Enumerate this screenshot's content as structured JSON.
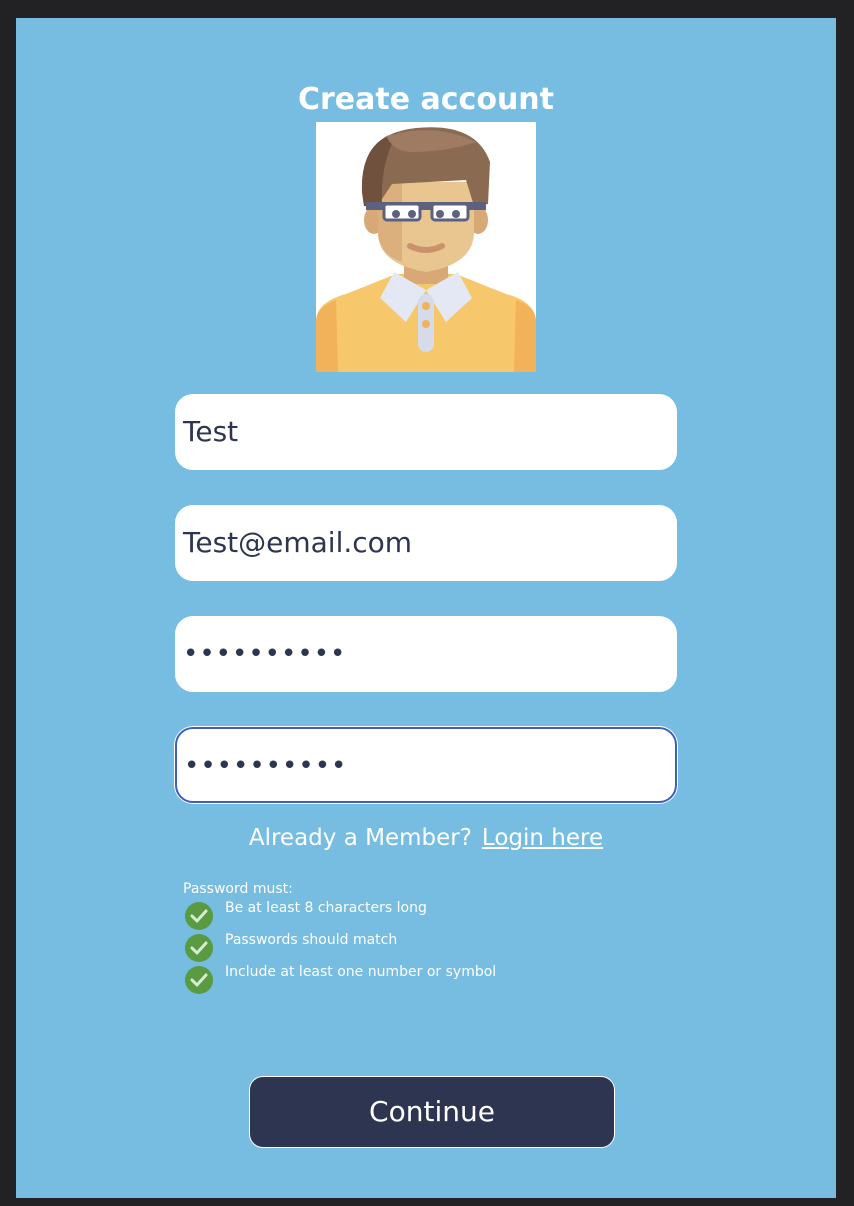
{
  "title": "Create account",
  "form": {
    "name_value": "Test",
    "email_value": "Test@email.com",
    "password_value": "••••••••••",
    "confirm_password_value": "••••••••••"
  },
  "login_prompt": {
    "text": "Already a Member?",
    "link": "Login here"
  },
  "password_rules": {
    "heading": "Password must:",
    "items": [
      {
        "label": "Be at least 8 characters long",
        "status": "met"
      },
      {
        "label": "Passwords should match",
        "status": "met"
      },
      {
        "label": "Include at least one number or symbol",
        "status": "met"
      }
    ]
  },
  "continue_label": "Continue",
  "icons": {
    "avatar": "man-with-glasses-avatar",
    "check": "green-check-circle-icon"
  },
  "colors": {
    "background": "#77bde1",
    "button": "#2e3550",
    "check": "#5a9a40",
    "focus_border": "#3f5fbf"
  }
}
